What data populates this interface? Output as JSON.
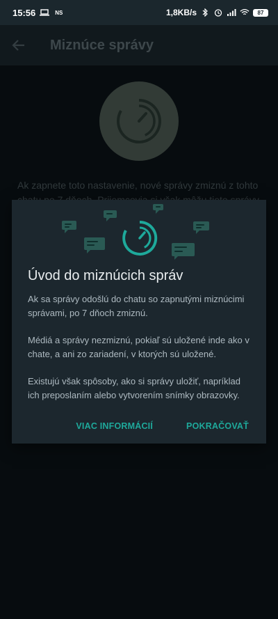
{
  "status_bar": {
    "time": "15:56",
    "ns_label": "NS",
    "net_speed": "1,8KB/s",
    "battery": "87",
    "icons": [
      "laptop-icon",
      "bluetooth-icon",
      "alarm-icon",
      "signal-icon",
      "wifi-icon",
      "battery-icon"
    ]
  },
  "app_bar": {
    "title": "Miznúce správy",
    "back_icon": "arrow-back-icon"
  },
  "page": {
    "description": "Ak zapnete toto nastavenie, nové správy zmiznú z tohto chatu po 7 dňoch. Prijemcovia si však môžu tieto správy"
  },
  "dialog": {
    "title": "Úvod do miznúcich správ",
    "paragraphs": [
      "Ak sa správy odošlú do chatu so zapnutými miznúcimi správami, po 7 dňoch zmiznú.",
      "Médiá a správy nezmiznú, pokiaľ sú uložené inde ako v chate, a ani zo zariadení, v ktorých sú uložené.",
      "Existujú však spôsoby, ako si správy uložiť, napríklad ich preposlaním alebo vytvorením snímky obrazovky."
    ],
    "more_info": "VIAC INFORMÁCIÍ",
    "continue": "POKRAČOVAŤ"
  },
  "colors": {
    "accent": "#1ea99b",
    "appbar": "#1b272d",
    "dialog_bg": "#1c272e",
    "hero_circle": "#4d5b54"
  }
}
